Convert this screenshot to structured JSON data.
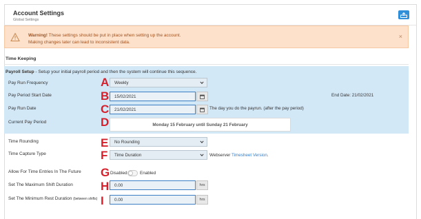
{
  "header": {
    "title": "Account Settings",
    "subtitle": "Global Settings"
  },
  "alert": {
    "strong": "Warning!",
    "line1": " These settings should be put in place when setting up the account.",
    "line2": "Making changes later can lead to inconsistent data.",
    "close": "×"
  },
  "section": {
    "title": "Time Keeping"
  },
  "payroll": {
    "intro_strong": "Payroll Setup",
    "intro_rest": " - Setup your initial payroll period and then the system will continue this sequence."
  },
  "fields": {
    "pay_run_frequency": {
      "label": "Pay Run Frequency",
      "value": "Weekly",
      "marker": "A"
    },
    "pay_period_start": {
      "label": "Pay Period Start Date",
      "value": "15/02/2021",
      "marker": "B",
      "end_date": "End Date: 21/02/2021"
    },
    "pay_run_date": {
      "label": "Pay Run Date",
      "value": "21/02/2021",
      "marker": "C",
      "note": "The day you do the payrun. (after the pay period)"
    },
    "current_pay_period": {
      "label": "Current Pay Period",
      "value": "Monday 15 February until Sunday 21 February",
      "marker": "D"
    },
    "time_rounding": {
      "label": "Time Rounding",
      "value": "No Rounding",
      "marker": "E"
    },
    "time_capture_type": {
      "label": "Time Capture Type",
      "value": "Time Duration",
      "marker": "F",
      "note": "Webserver ",
      "link": "Timesheet Version",
      "note_end": "."
    },
    "future_entries": {
      "label": "Allow For Time Entries In The Future",
      "marker": "G",
      "off_label": "Disabled",
      "on_label": "Enabled",
      "enabled": false
    },
    "max_shift": {
      "label": "Set The Maximum Shift Duration",
      "value": "0.00",
      "unit": "hrs",
      "marker": "H"
    },
    "min_rest": {
      "label": "Set The Minimum Rest Duration",
      "label_small": "(between shifts)",
      "value": "0.00",
      "unit": "hrs",
      "marker": "I"
    }
  },
  "colors": {
    "accent": "#2f8fd8",
    "alert_bg": "#fde1cb",
    "alert_text": "#a25320",
    "info_bg": "#d3e8f7",
    "marker": "#d51f2a"
  }
}
